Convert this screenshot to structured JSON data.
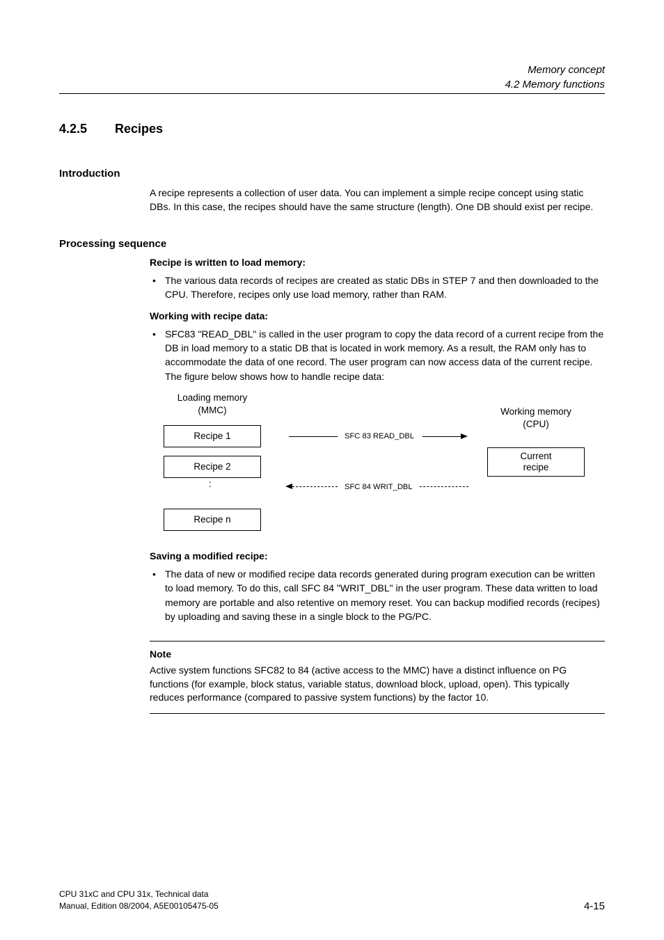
{
  "header": {
    "line1": "Memory concept",
    "line2": "4.2 Memory functions"
  },
  "section": {
    "number": "4.2.5",
    "title": "Recipes"
  },
  "intro": {
    "heading": "Introduction",
    "text": "A recipe represents a collection of user data. You can implement a simple recipe concept using static DBs. In this case, the recipes should have the same structure (length). One DB should exist per recipe."
  },
  "processing": {
    "heading": "Processing sequence",
    "write_heading": "Recipe is written to load memory:",
    "write_bullet": "The various data records of recipes are created as static DBs in STEP 7 and then downloaded to the CPU. Therefore, recipes only use load memory, rather than RAM.",
    "work_heading": "Working with recipe data:",
    "work_bullet": "SFC83 \"READ_DBL\" is called in the user program to copy the data record of a current recipe from the DB in load memory to a static DB that is located in work memory. As a result, the RAM only has to accommodate the data of one record. The user program can now access data of the current recipe. The figure below shows how to handle recipe data:",
    "saving_heading": "Saving a modified recipe:",
    "saving_bullet": "The data of new or modified recipe data records generated during program execution can be written to load memory. To do this, call SFC 84 \"WRIT_DBL\" in the user program. These data written to load memory are portable and also retentive on memory reset. You can backup modified records (recipes) by uploading and saving these in a single block to the PG/PC."
  },
  "diagram": {
    "loading_label_l1": "Loading memory",
    "loading_label_l2": "(MMC)",
    "working_label_l1": "Working memory",
    "working_label_l2": "(CPU)",
    "recipe1": "Recipe 1",
    "recipe2": "Recipe 2",
    "recipen": "Recipe n",
    "dots": ":",
    "current_l1": "Current",
    "current_l2": "recipe",
    "sfc83": "SFC 83 READ_DBL",
    "sfc84": "SFC 84 WRIT_DBL"
  },
  "note": {
    "title": "Note",
    "body": "Active system functions SFC82 to 84 (active access to the MMC) have a distinct influence on PG functions (for example, block status, variable status, download block, upload, open). This typically reduces performance (compared to passive system functions) by the factor 10."
  },
  "footer": {
    "line1": "CPU 31xC and CPU 31x, Technical data",
    "line2": "Manual, Edition 08/2004, A5E00105475-05",
    "pagenum": "4-15"
  }
}
